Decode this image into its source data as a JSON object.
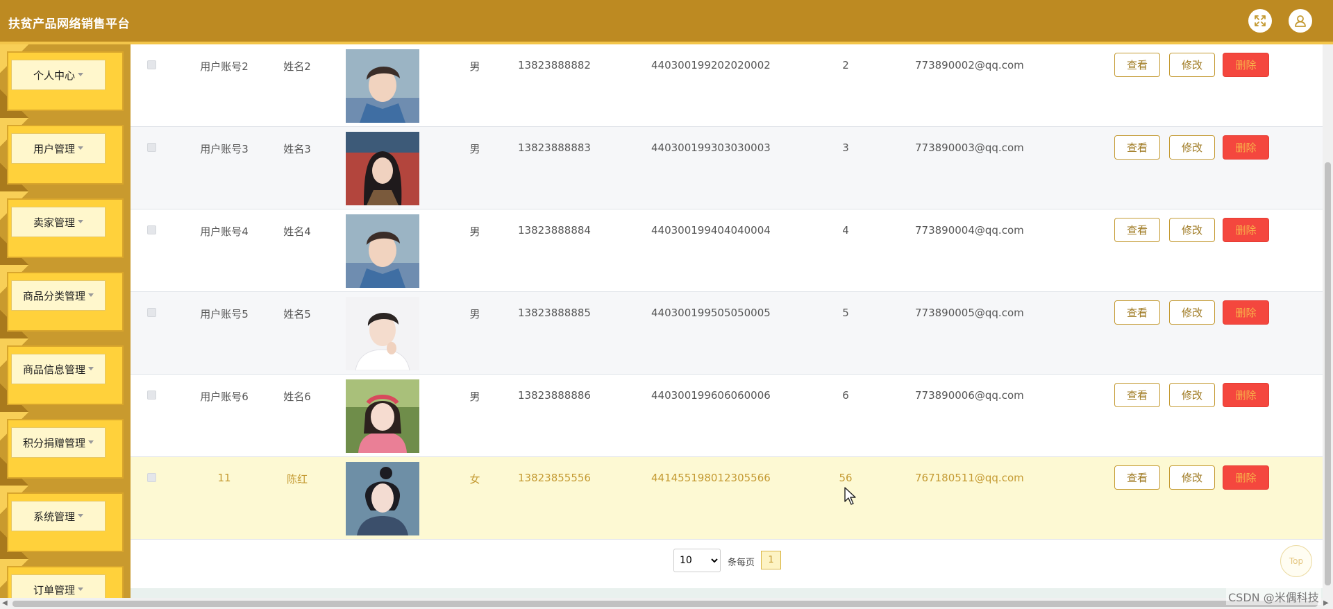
{
  "app": {
    "title": "扶贫产品网络销售平台"
  },
  "header": {
    "fullscreen_icon": "fullscreen-icon",
    "user_icon": "user-icon"
  },
  "colors": {
    "header": "#bd8a22",
    "sidebar": "#e8b73a",
    "accent": "#c49a32",
    "danger": "#f4473e",
    "highlight_row": "#fdf9d3"
  },
  "sidebar": {
    "items": [
      {
        "label": "个人中心"
      },
      {
        "label": "用户管理"
      },
      {
        "label": "卖家管理"
      },
      {
        "label": "商品分类管理"
      },
      {
        "label": "商品信息管理"
      },
      {
        "label": "积分捐赠管理"
      },
      {
        "label": "系统管理"
      },
      {
        "label": "订单管理"
      }
    ]
  },
  "table": {
    "rows": [
      {
        "account": "用户账号2",
        "name": "姓名2",
        "gender": "男",
        "phone": "13823888882",
        "id_card": "440300199202020002",
        "points": "2",
        "email": "773890002@qq.com",
        "avatar": "young-man-denim-photo"
      },
      {
        "account": "用户账号3",
        "name": "姓名3",
        "gender": "男",
        "phone": "13823888883",
        "id_card": "440300199303030003",
        "points": "3",
        "email": "773890003@qq.com",
        "avatar": "young-woman-dark-hair-photo"
      },
      {
        "account": "用户账号4",
        "name": "姓名4",
        "gender": "男",
        "phone": "13823888884",
        "id_card": "440300199404040004",
        "points": "4",
        "email": "773890004@qq.com",
        "avatar": "young-man-denim-photo"
      },
      {
        "account": "用户账号5",
        "name": "姓名5",
        "gender": "男",
        "phone": "13823888885",
        "id_card": "440300199505050005",
        "points": "5",
        "email": "773890005@qq.com",
        "avatar": "young-man-white-shirt-photo"
      },
      {
        "account": "用户账号6",
        "name": "姓名6",
        "gender": "男",
        "phone": "13823888886",
        "id_card": "440300199606060006",
        "points": "6",
        "email": "773890006@qq.com",
        "avatar": "young-woman-headband-photo"
      },
      {
        "account": "11",
        "name": "陈红",
        "gender": "女",
        "phone": "13823855556",
        "id_card": "441455198012305566",
        "points": "56",
        "email": "767180511@qq.com",
        "avatar": "cartoon-girl-illustration"
      }
    ],
    "actions": {
      "view": "查看",
      "edit": "修改",
      "delete": "删除"
    }
  },
  "pagination": {
    "page_size": "10",
    "page_size_options": [
      "10"
    ],
    "per_page_label": "条每页",
    "current_page": "1"
  },
  "top_button": "Top",
  "watermark": "CSDN @米偶科技"
}
